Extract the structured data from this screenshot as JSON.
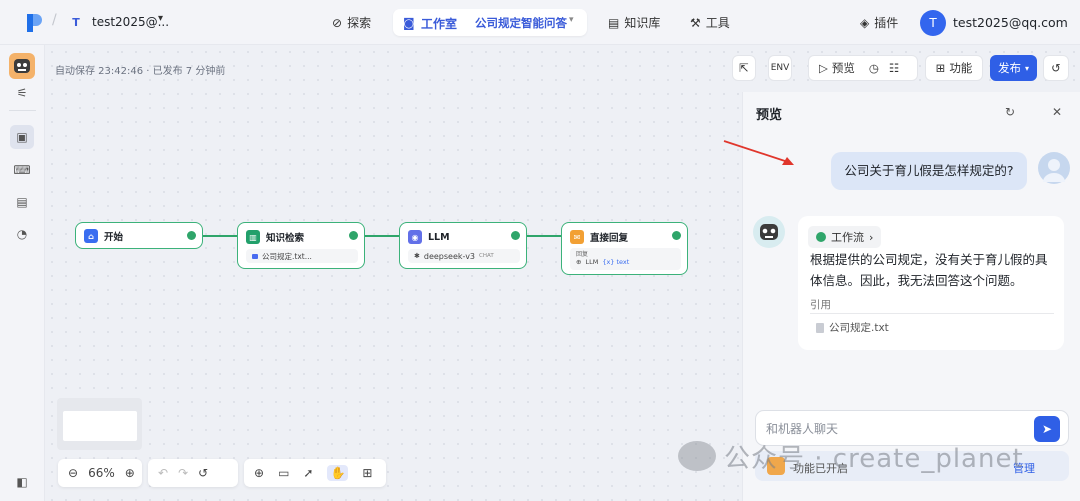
{
  "header": {
    "workspace_badge": "T",
    "workspace_name": "test2025@...",
    "nav": {
      "explore": "探索",
      "studio": "工作室",
      "app_name": "公司规定智能问答",
      "knowledge": "知识库",
      "tools": "工具",
      "plugins": "插件"
    },
    "user_initial": "T",
    "user_email": "test2025@qq.com"
  },
  "canvas": {
    "autosave_text": "自动保存 23:42:46 · 已发布 7 分钟前",
    "toolbar": {
      "preview_label": "预览",
      "features_label": "功能",
      "publish_label": "发布"
    },
    "nodes": {
      "start": {
        "title": "开始"
      },
      "knowledge": {
        "title": "知识检索",
        "sub": "公司规定.txt..."
      },
      "llm": {
        "title": "LLM",
        "model": "deepseek-v3",
        "model_tag": "CHAT"
      },
      "answer": {
        "title": "直接回复",
        "sub_label": "回复",
        "var_src": "LLM",
        "var_name": "{x} text"
      }
    },
    "zoom": "66%"
  },
  "preview": {
    "title": "预览",
    "user_message": "公司关于育儿假是怎样规定的?",
    "workflow_tag": "工作流",
    "bot_message": "根据提供的公司规定，没有关于育儿假的具体信息。因此，我无法回答这个问题。",
    "citation_label": "引用",
    "citation_file": "公司规定.txt",
    "input_placeholder": "和机器人聊天",
    "feature_text": "功能已开启",
    "manage_label": "管理"
  },
  "watermark": "公众号 · create_planet",
  "colors": {
    "accent": "#2f5fe6",
    "success": "#2fa56a",
    "user_bubble": "#dce6f7"
  }
}
